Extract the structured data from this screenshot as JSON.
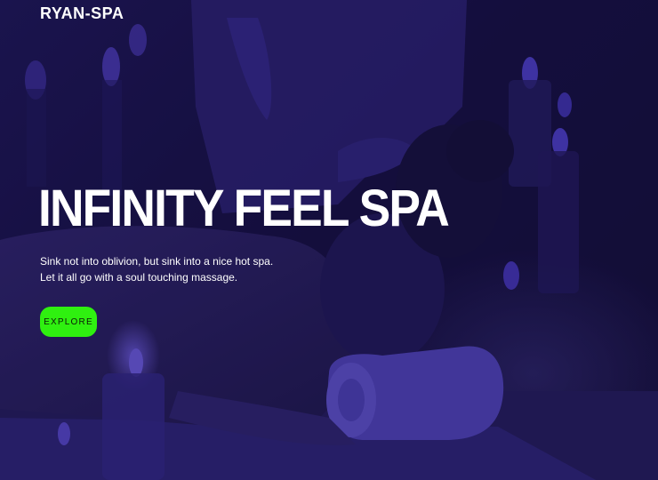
{
  "nav": {
    "brand": "RYAN-SPA"
  },
  "hero": {
    "title": "INFINITY FEEL SPA",
    "tagline_line1": "Sink not into oblivion, but sink into a nice hot spa.",
    "tagline_line2": "Let it all go with a soul touching massage.",
    "cta_label": "EXPLORE"
  },
  "colors": {
    "overlay": "#2a1f8a",
    "cta_background": "#2ff010",
    "text": "#ffffff"
  }
}
